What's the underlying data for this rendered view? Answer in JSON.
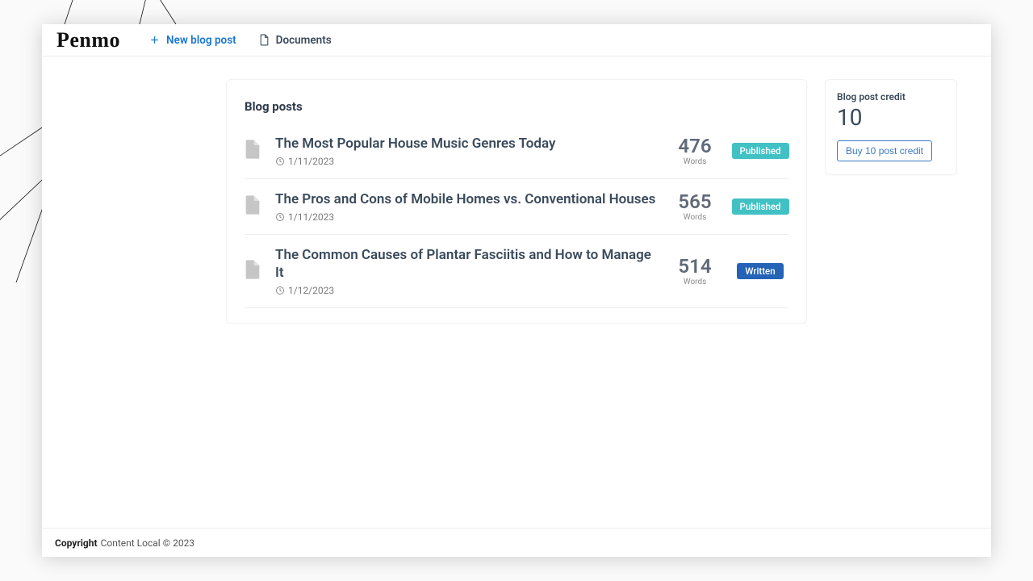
{
  "brand": "Penmo",
  "nav": {
    "new_post": "New blog post",
    "documents": "Documents"
  },
  "main": {
    "heading": "Blog posts",
    "words_label": "Words",
    "posts": [
      {
        "title": "The Most Popular House Music Genres Today",
        "date": "1/11/2023",
        "words": "476",
        "status": "Published",
        "status_kind": "published"
      },
      {
        "title": "The Pros and Cons of Mobile Homes vs. Conventional Houses",
        "date": "1/11/2023",
        "words": "565",
        "status": "Published",
        "status_kind": "published"
      },
      {
        "title": "The Common Causes of Plantar Fasciitis and How to Manage It",
        "date": "1/12/2023",
        "words": "514",
        "status": "Written",
        "status_kind": "written"
      }
    ]
  },
  "credit": {
    "label": "Blog post credit",
    "value": "10",
    "buy_label": "Buy 10 post credit"
  },
  "footer": {
    "copyright_bold": "Copyright",
    "copyright_rest": "Content Local © 2023"
  }
}
